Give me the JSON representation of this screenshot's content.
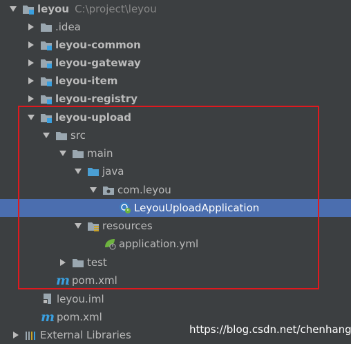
{
  "tree": {
    "root": {
      "label": "leyou",
      "path": "C:\\project\\leyou"
    },
    "items": [
      {
        "label": ".idea"
      },
      {
        "label": "leyou-common"
      },
      {
        "label": "leyou-gateway"
      },
      {
        "label": "leyou-item"
      },
      {
        "label": "leyou-registry"
      },
      {
        "label": "leyou-upload"
      },
      {
        "label": "src"
      },
      {
        "label": "main"
      },
      {
        "label": "java"
      },
      {
        "label": "com.leyou"
      },
      {
        "label": "LeyouUploadApplication"
      },
      {
        "label": "resources"
      },
      {
        "label": "application.yml"
      },
      {
        "label": "test"
      },
      {
        "label": "pom.xml"
      },
      {
        "label": "leyou.iml"
      },
      {
        "label": "pom.xml"
      },
      {
        "label": "External Libraries"
      }
    ]
  },
  "watermark": "https://blog.csdn.net/chenhangx",
  "colors": {
    "background": "#3c3f41",
    "selection": "#4b6eaf",
    "highlight_border": "#e0191e",
    "folder": "#9aa7b0",
    "module_dot": "#3aa0e0",
    "source_folder": "#4a9fd4",
    "maven": "#3aa0e0"
  }
}
